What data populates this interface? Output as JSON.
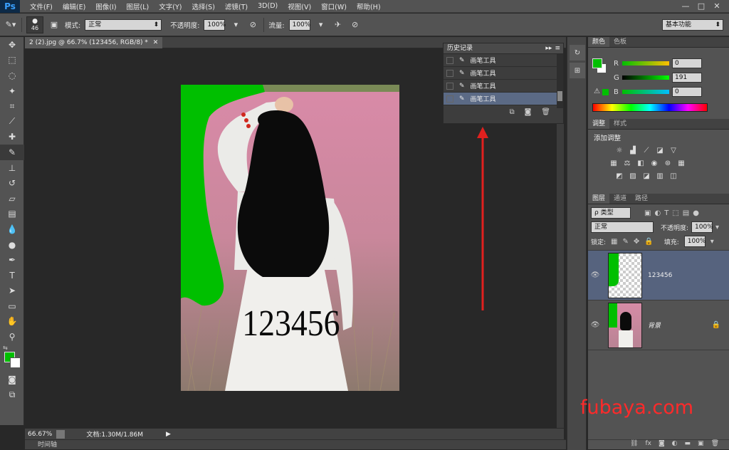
{
  "app": {
    "logo": "Ps"
  },
  "menu": [
    "文件(F)",
    "编辑(E)",
    "图像(I)",
    "图层(L)",
    "文字(Y)",
    "选择(S)",
    "滤镜(T)",
    "3D(D)",
    "视图(V)",
    "窗口(W)",
    "帮助(H)"
  ],
  "window_controls": {
    "minimize": "—",
    "maximize": "□",
    "close": "✕"
  },
  "options": {
    "brush_size": "46",
    "mode_label": "模式:",
    "mode_value": "正常",
    "opacity_label": "不透明度:",
    "opacity_value": "100%",
    "flow_label": "流量:",
    "flow_value": "100%",
    "workspace": "基本功能"
  },
  "document": {
    "tab_title": "2 (2).jpg @ 66.7% (123456, RGB/8) *",
    "overlay_text": "123456",
    "zoom": "66.67%",
    "doc_size": "文档:1.30M/1.86M"
  },
  "timeline": {
    "label": "时间轴"
  },
  "history": {
    "title": "历史记录",
    "items": [
      "画笔工具",
      "画笔工具",
      "画笔工具",
      "画笔工具"
    ]
  },
  "color_panel": {
    "tabs": [
      "颜色",
      "色板"
    ],
    "r_label": "R",
    "r_value": "0",
    "g_label": "G",
    "g_value": "191",
    "b_label": "B",
    "b_value": "0",
    "foreground": "#00bf00"
  },
  "adjust_panel": {
    "tabs": [
      "调整",
      "样式"
    ],
    "heading": "添加调整"
  },
  "layers_panel": {
    "tabs": [
      "图层",
      "通道",
      "路径"
    ],
    "filter": "ρ 类型",
    "blend": "正常",
    "opacity_label": "不透明度:",
    "opacity_value": "100%",
    "lock_label": "锁定:",
    "fill_label": "填充:",
    "fill_value": "100%",
    "layers": [
      {
        "name": "123456"
      },
      {
        "name": "背景"
      }
    ]
  },
  "watermark": "fubaya.com",
  "colors": {
    "accent_arrow": "#e0201e",
    "green": "#00bf00"
  }
}
